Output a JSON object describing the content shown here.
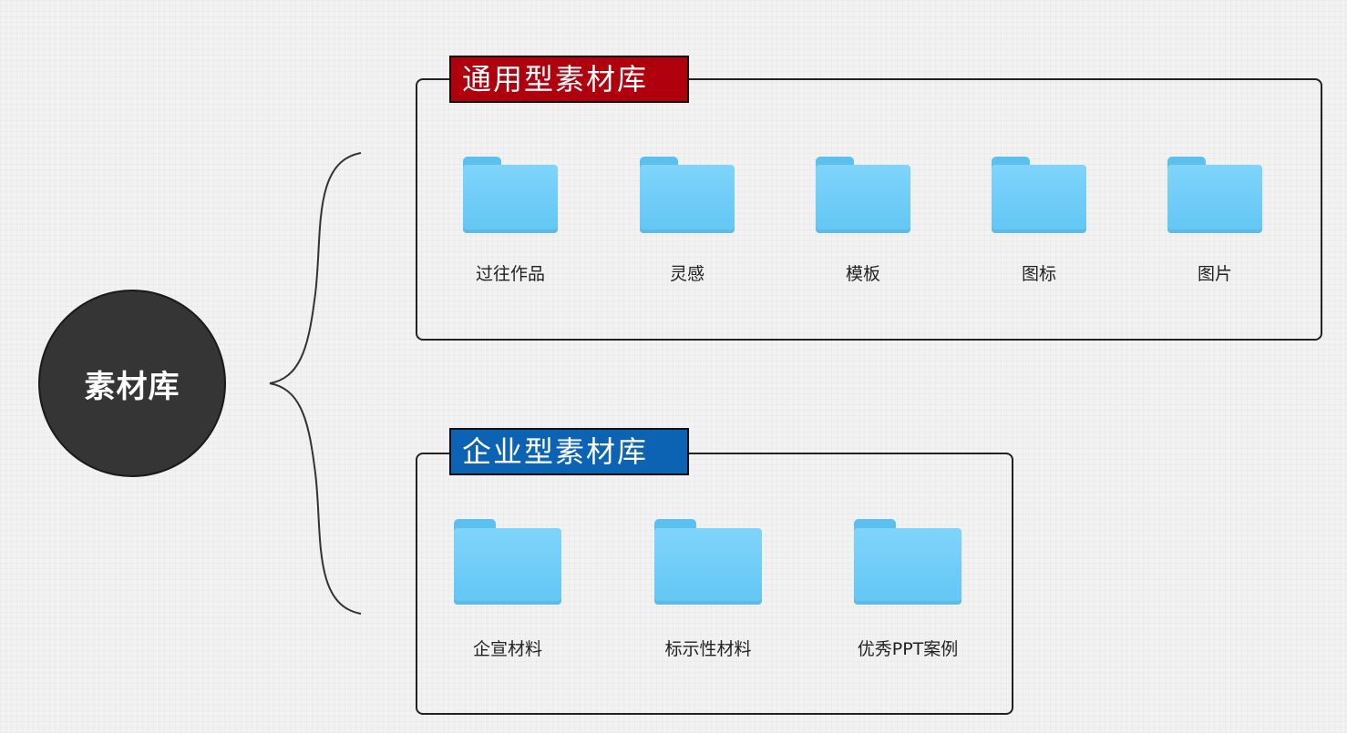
{
  "root": {
    "label": "素材库"
  },
  "groups": [
    {
      "title": "通用型素材库",
      "color": "#b0000e",
      "folders": [
        "过往作品",
        "灵感",
        "模板",
        "图标",
        "图片"
      ]
    },
    {
      "title": "企业型素材库",
      "color": "#0c63b4",
      "folders": [
        "企宣材料",
        "标示性材料",
        "优秀PPT案例"
      ]
    }
  ],
  "icons": {
    "folder": "folder-icon"
  },
  "colors": {
    "folder": "#6ccbf6",
    "root": "#353535"
  }
}
